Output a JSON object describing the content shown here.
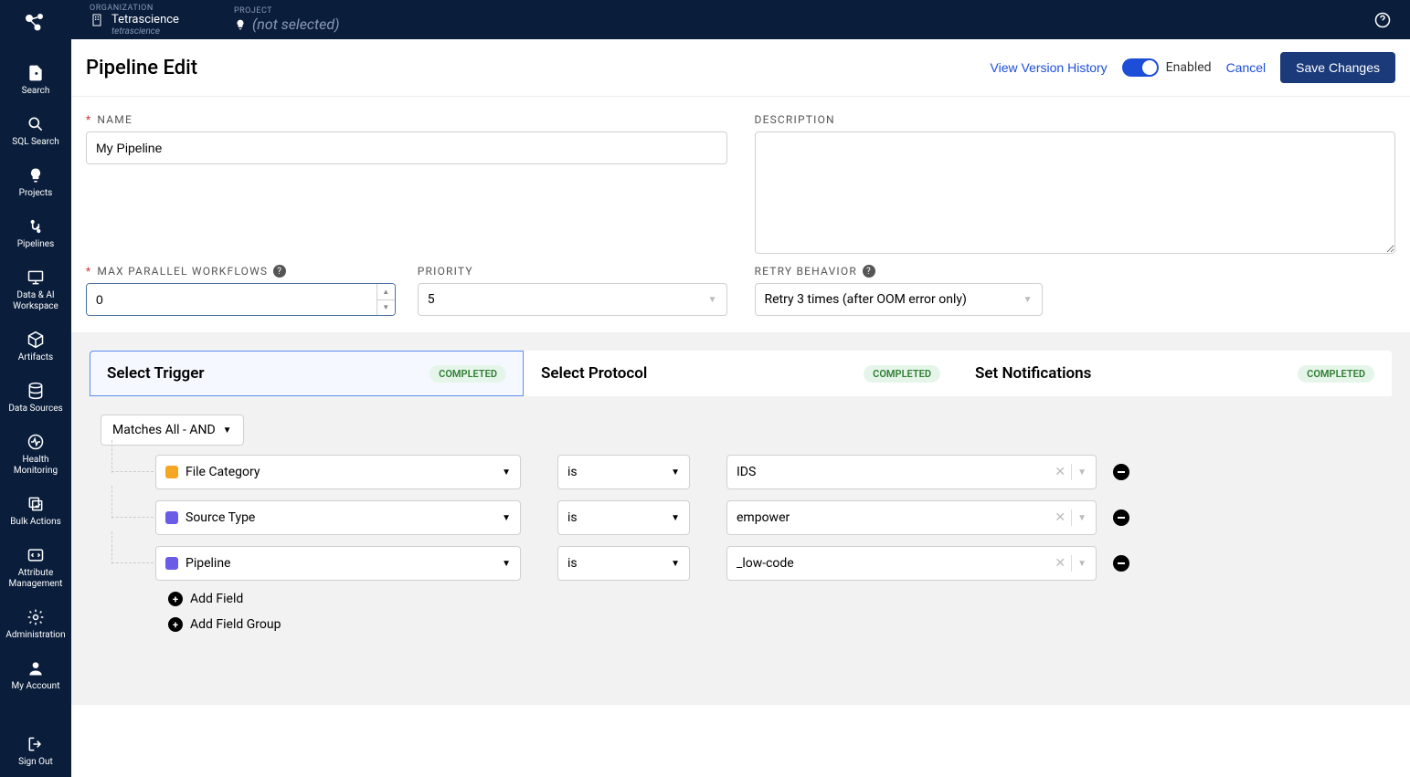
{
  "topbar": {
    "org_label": "ORGANIZATION",
    "org_name": "Tetrascience",
    "org_sub": "tetrascience",
    "project_label": "PROJECT",
    "project_value": "(not selected)"
  },
  "sidebar": {
    "items": [
      {
        "label": "Search"
      },
      {
        "label": "SQL Search"
      },
      {
        "label": "Projects"
      },
      {
        "label": "Pipelines"
      },
      {
        "label": "Data & AI Workspace"
      },
      {
        "label": "Artifacts"
      },
      {
        "label": "Data Sources"
      },
      {
        "label": "Health Monitoring"
      },
      {
        "label": "Bulk Actions"
      },
      {
        "label": "Attribute Management"
      },
      {
        "label": "Administration"
      },
      {
        "label": "My Account"
      }
    ],
    "signout": "Sign Out"
  },
  "page": {
    "title": "Pipeline Edit",
    "view_history": "View Version History",
    "enabled_label": "Enabled",
    "cancel": "Cancel",
    "save": "Save Changes"
  },
  "form": {
    "name_label": "NAME",
    "name_value": "My Pipeline",
    "desc_label": "DESCRIPTION",
    "desc_value": "",
    "max_parallel_label": "MAX PARALLEL WORKFLOWS",
    "max_parallel_value": "0",
    "priority_label": "PRIORITY",
    "priority_value": "5",
    "retry_label": "RETRY BEHAVIOR",
    "retry_value": "Retry 3 times (after OOM error only)"
  },
  "steps": {
    "tabs": [
      {
        "title": "Select Trigger",
        "badge": "COMPLETED"
      },
      {
        "title": "Select Protocol",
        "badge": "COMPLETED"
      },
      {
        "title": "Set Notifications",
        "badge": "COMPLETED"
      }
    ],
    "match_mode": "Matches All - AND",
    "conditions": [
      {
        "field": "File Category",
        "color": "#f5a623",
        "op": "is",
        "value": "IDS"
      },
      {
        "field": "Source Type",
        "color": "#6b5ce7",
        "op": "is",
        "value": "empower"
      },
      {
        "field": "Pipeline",
        "color": "#6b5ce7",
        "op": "is",
        "value": "_low-code"
      }
    ],
    "add_field": "Add Field",
    "add_group": "Add Field Group"
  }
}
